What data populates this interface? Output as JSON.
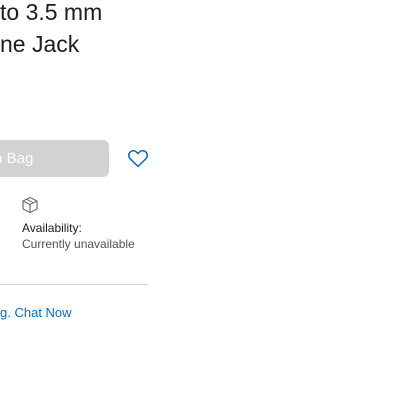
{
  "product": {
    "title_line1": "to 3.5 mm",
    "title_line2": "ne Jack"
  },
  "purchase": {
    "add_to_bag_label": "to Bag",
    "favorite_icon": "heart-outline-icon",
    "button_color": "#d2d2d2"
  },
  "availability": {
    "icon": "box-icon",
    "label": "Availability:",
    "status": "Currently unavailable"
  },
  "help": {
    "prefix": "g.",
    "chat_label": "Chat Now",
    "link_color": "#0070c9"
  }
}
